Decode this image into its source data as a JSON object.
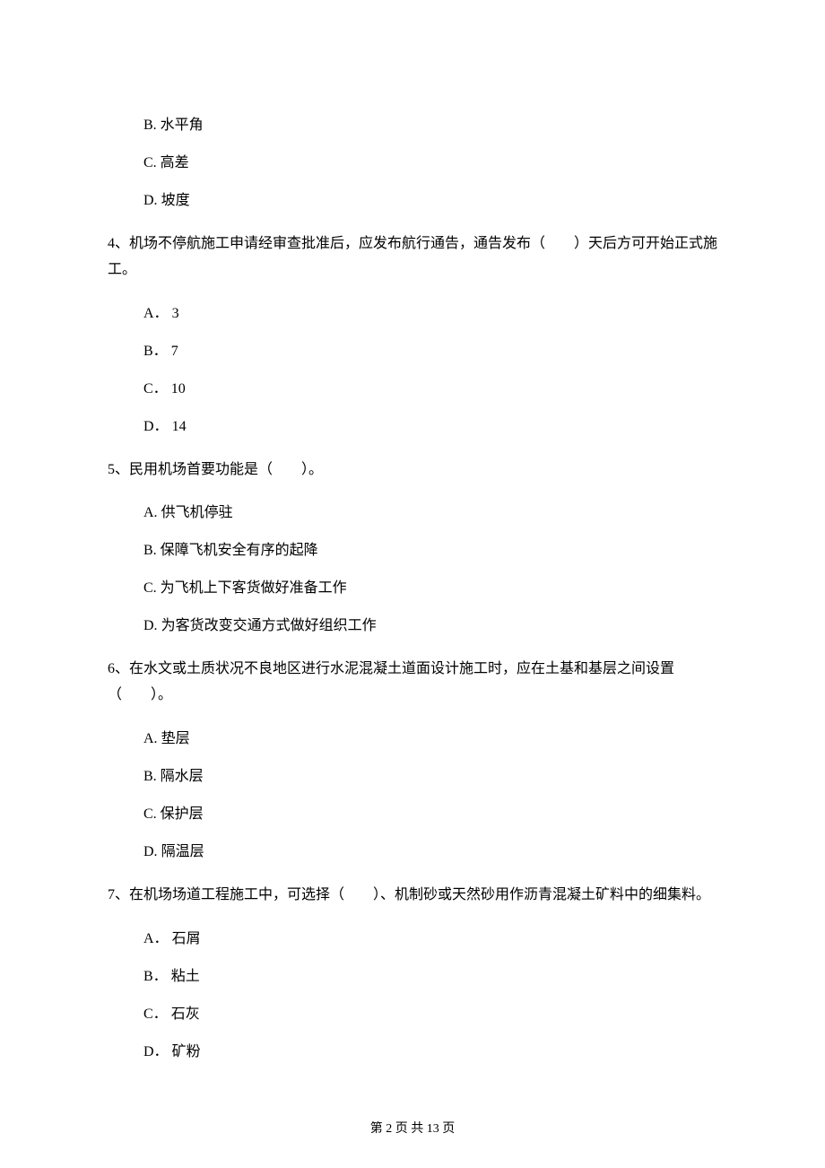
{
  "options_leading": [
    {
      "label": "B.",
      "text": "水平角"
    },
    {
      "label": "C.",
      "text": "高差"
    },
    {
      "label": "D.",
      "text": "坡度"
    }
  ],
  "q4": {
    "text": "4、机场不停航施工申请经审查批准后，应发布航行通告，通告发布（　　）天后方可开始正式施工。",
    "options": [
      {
        "label": "A．",
        "text": "3"
      },
      {
        "label": "B．",
        "text": "7"
      },
      {
        "label": "C．",
        "text": "10"
      },
      {
        "label": "D．",
        "text": "14"
      }
    ]
  },
  "q5": {
    "text": "5、民用机场首要功能是（　　）。",
    "options": [
      {
        "label": "A.",
        "text": "供飞机停驻"
      },
      {
        "label": "B.",
        "text": "保障飞机安全有序的起降"
      },
      {
        "label": "C.",
        "text": "为飞机上下客货做好准备工作"
      },
      {
        "label": "D.",
        "text": "为客货改变交通方式做好组织工作"
      }
    ]
  },
  "q6": {
    "text": "6、在水文或土质状况不良地区进行水泥混凝土道面设计施工时，应在土基和基层之间设置（　　）。",
    "options": [
      {
        "label": "A.",
        "text": "垫层"
      },
      {
        "label": "B.",
        "text": "隔水层"
      },
      {
        "label": "C.",
        "text": "保护层"
      },
      {
        "label": "D.",
        "text": "隔温层"
      }
    ]
  },
  "q7": {
    "text": "7、在机场场道工程施工中，可选择（　　）、机制砂或天然砂用作沥青混凝土矿料中的细集料。",
    "options": [
      {
        "label": "A．",
        "text": "石屑"
      },
      {
        "label": "B．",
        "text": "粘土"
      },
      {
        "label": "C．",
        "text": "石灰"
      },
      {
        "label": "D．",
        "text": "矿粉"
      }
    ]
  },
  "footer": "第 2 页 共 13 页"
}
